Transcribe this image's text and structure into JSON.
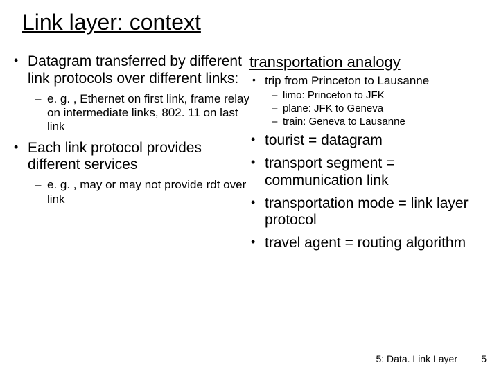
{
  "title": "Link layer: context",
  "left": {
    "b1": "Datagram transferred by different link protocols over different links:",
    "b1sub": "e. g. , Ethernet on first link, frame relay on intermediate links, 802. 11 on last link",
    "b2": "Each  link protocol provides different services",
    "b2sub": "e. g. , may or may not provide rdt over link"
  },
  "right": {
    "heading": "transportation analogy",
    "trip": "trip from Princeton to Lausanne",
    "tripsubs": [
      "limo: Princeton to JFK",
      "plane: JFK to Geneva",
      "train: Geneva to Lausanne"
    ],
    "p2": "tourist = datagram",
    "p3": "transport segment = communication link",
    "p4": "transportation mode = link layer protocol",
    "p5": "travel agent = routing algorithm"
  },
  "footer": {
    "label": "5: Data. Link Layer",
    "num": "5"
  }
}
